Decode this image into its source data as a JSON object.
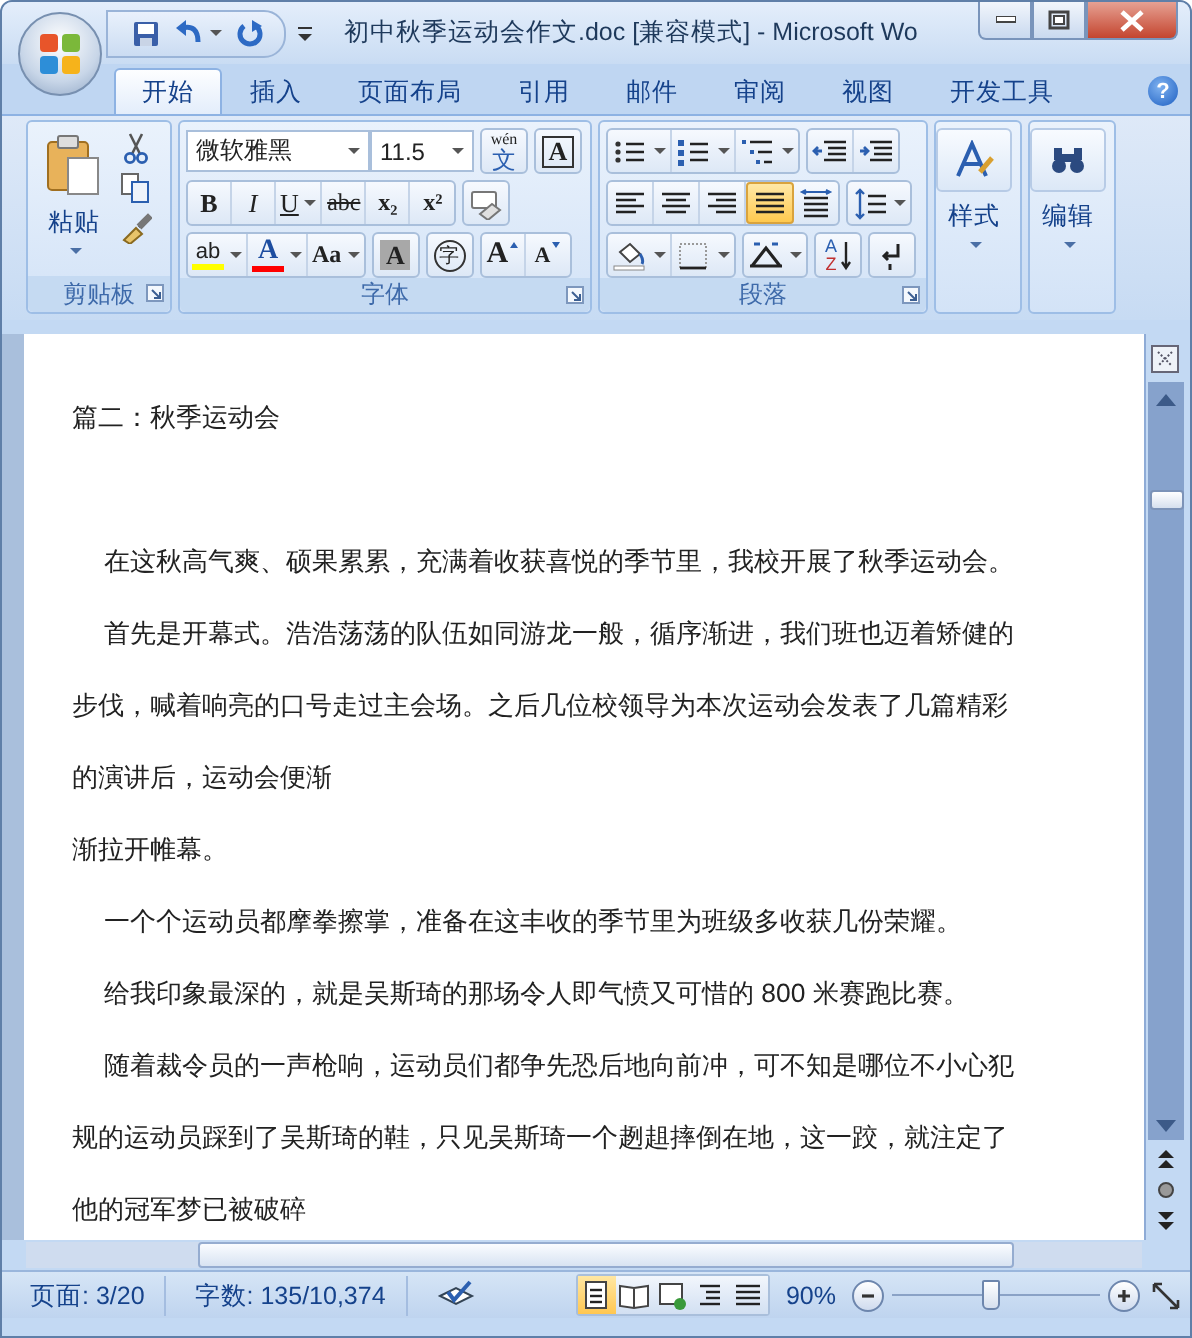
{
  "window": {
    "title": "初中秋季运动会作文.doc [兼容模式] - Microsoft Wo"
  },
  "tabs": [
    {
      "label": "开始",
      "selected": true
    },
    {
      "label": "插入",
      "selected": false
    },
    {
      "label": "页面布局",
      "selected": false
    },
    {
      "label": "引用",
      "selected": false
    },
    {
      "label": "邮件",
      "selected": false
    },
    {
      "label": "审阅",
      "selected": false
    },
    {
      "label": "视图",
      "selected": false
    },
    {
      "label": "开发工具",
      "selected": false
    }
  ],
  "help": "?",
  "clipboard": {
    "title": "剪贴板",
    "paste": "粘贴"
  },
  "font": {
    "title": "字体",
    "font_name": "微软雅黑",
    "font_size": "11.5",
    "rows": [
      {
        "strips": [
          {
            "buttons": [
              {
                "kind": "phonetic",
                "top": "wén",
                "glyph": "文"
              }
            ]
          },
          {
            "buttons": [
              {
                "kind": "border",
                "glyph": "A"
              }
            ]
          }
        ]
      },
      {
        "strips": [
          {
            "buttons": [
              {
                "kind": "bold",
                "glyph": "B"
              },
              {
                "kind": "italic",
                "glyph": "I"
              },
              {
                "kind": "underline",
                "glyph": "U"
              },
              {
                "kind": "strike",
                "glyph": "abc"
              },
              {
                "kind": "sub",
                "glyph": "x₂"
              },
              {
                "kind": "sup",
                "glyph": "x²"
              }
            ]
          },
          {
            "buttons": [
              {
                "kind": "clear"
              }
            ]
          }
        ]
      },
      {
        "strips": [
          {
            "buttons": [
              {
                "kind": "highlight",
                "glyph": "ab",
                "color": "#ffff00"
              },
              {
                "kind": "color",
                "glyph": "A",
                "color": "#ff0000"
              },
              {
                "kind": "case",
                "glyph": "Aa"
              }
            ]
          },
          {
            "buttons": [
              {
                "kind": "shade",
                "glyph": "A"
              }
            ]
          },
          {
            "buttons": [
              {
                "kind": "enclose",
                "glyph": "字"
              }
            ]
          },
          {
            "buttons": [
              {
                "kind": "grow",
                "glyph": "A"
              },
              {
                "kind": "shrink",
                "glyph": "A"
              }
            ]
          }
        ]
      }
    ]
  },
  "paragraph": {
    "title": "段落",
    "rows": [
      {
        "strips": [
          {
            "buttons": [
              {
                "kind": "bullets"
              },
              {
                "kind": "numbering"
              },
              {
                "kind": "multilevel"
              }
            ]
          },
          {
            "buttons": [
              {
                "kind": "outdent"
              },
              {
                "kind": "indent"
              }
            ]
          }
        ]
      },
      {
        "strips": [
          {
            "buttons": [
              {
                "kind": "left",
                "selected": false
              },
              {
                "kind": "center",
                "selected": false
              },
              {
                "kind": "right",
                "selected": false
              },
              {
                "kind": "justify",
                "selected": true
              },
              {
                "kind": "distribute",
                "selected": false
              }
            ]
          },
          {
            "buttons": [
              {
                "kind": "spacing"
              }
            ]
          }
        ]
      },
      {
        "strips": [
          {
            "buttons": [
              {
                "kind": "fill"
              },
              {
                "kind": "borders"
              }
            ]
          },
          {
            "buttons": [
              {
                "kind": "layout"
              }
            ]
          },
          {
            "buttons": [
              {
                "kind": "sort",
                "glyph": "A",
                "glyph2": "Z"
              }
            ]
          },
          {
            "buttons": [
              {
                "kind": "marks"
              }
            ]
          }
        ]
      }
    ]
  },
  "styles": {
    "label": "样式"
  },
  "editing": {
    "label": "编辑"
  },
  "document": {
    "heading": "篇二：秋季运动会",
    "lines": [
      {
        "text": "在这秋高气爽、硕果累累，充满着收获喜悦的季节里，我校开展了秋季运动会。",
        "indent": true
      },
      {
        "text": "首先是开幕式。浩浩荡荡的队伍如同游龙一般，循序渐进，我们班也迈着矫健的",
        "indent": true
      },
      {
        "text": "步伐，喊着响亮的口号走过主会场。之后几位校领导为本次运动会发表了几篇精彩",
        "indent": false
      },
      {
        "text": "的演讲后，运动会便渐",
        "indent": false
      },
      {
        "text": "渐拉开帷幕。",
        "indent": false
      },
      {
        "text": "一个个运动员都摩拳擦掌，准备在这丰收的季节里为班级多收获几份荣耀。",
        "indent": true
      },
      {
        "text": "给我印象最深的，就是吴斯琦的那场令人即气愤又可惜的 800 米赛跑比赛。",
        "indent": true
      },
      {
        "text": "随着裁令员的一声枪响，运动员们都争先恐后地向前冲，可不知是哪位不小心犯",
        "indent": true
      },
      {
        "text": "规的运动员踩到了吴斯琦的鞋，只见吴斯琦一个趔趄摔倒在地，这一跤，就注定了",
        "indent": false
      },
      {
        "text": "他的冠军梦已被破碎",
        "indent": false
      }
    ]
  },
  "status_bar": {
    "page": "页面: 3/20",
    "words": "字数: 135/10,374",
    "views": [
      {
        "kind": "print",
        "selected": true
      },
      {
        "kind": "reading",
        "selected": false
      },
      {
        "kind": "web",
        "selected": false
      },
      {
        "kind": "outline",
        "selected": false
      },
      {
        "kind": "draft",
        "selected": false
      }
    ],
    "zoom": "90%",
    "zoom_slider": {
      "level": 0.47
    }
  }
}
